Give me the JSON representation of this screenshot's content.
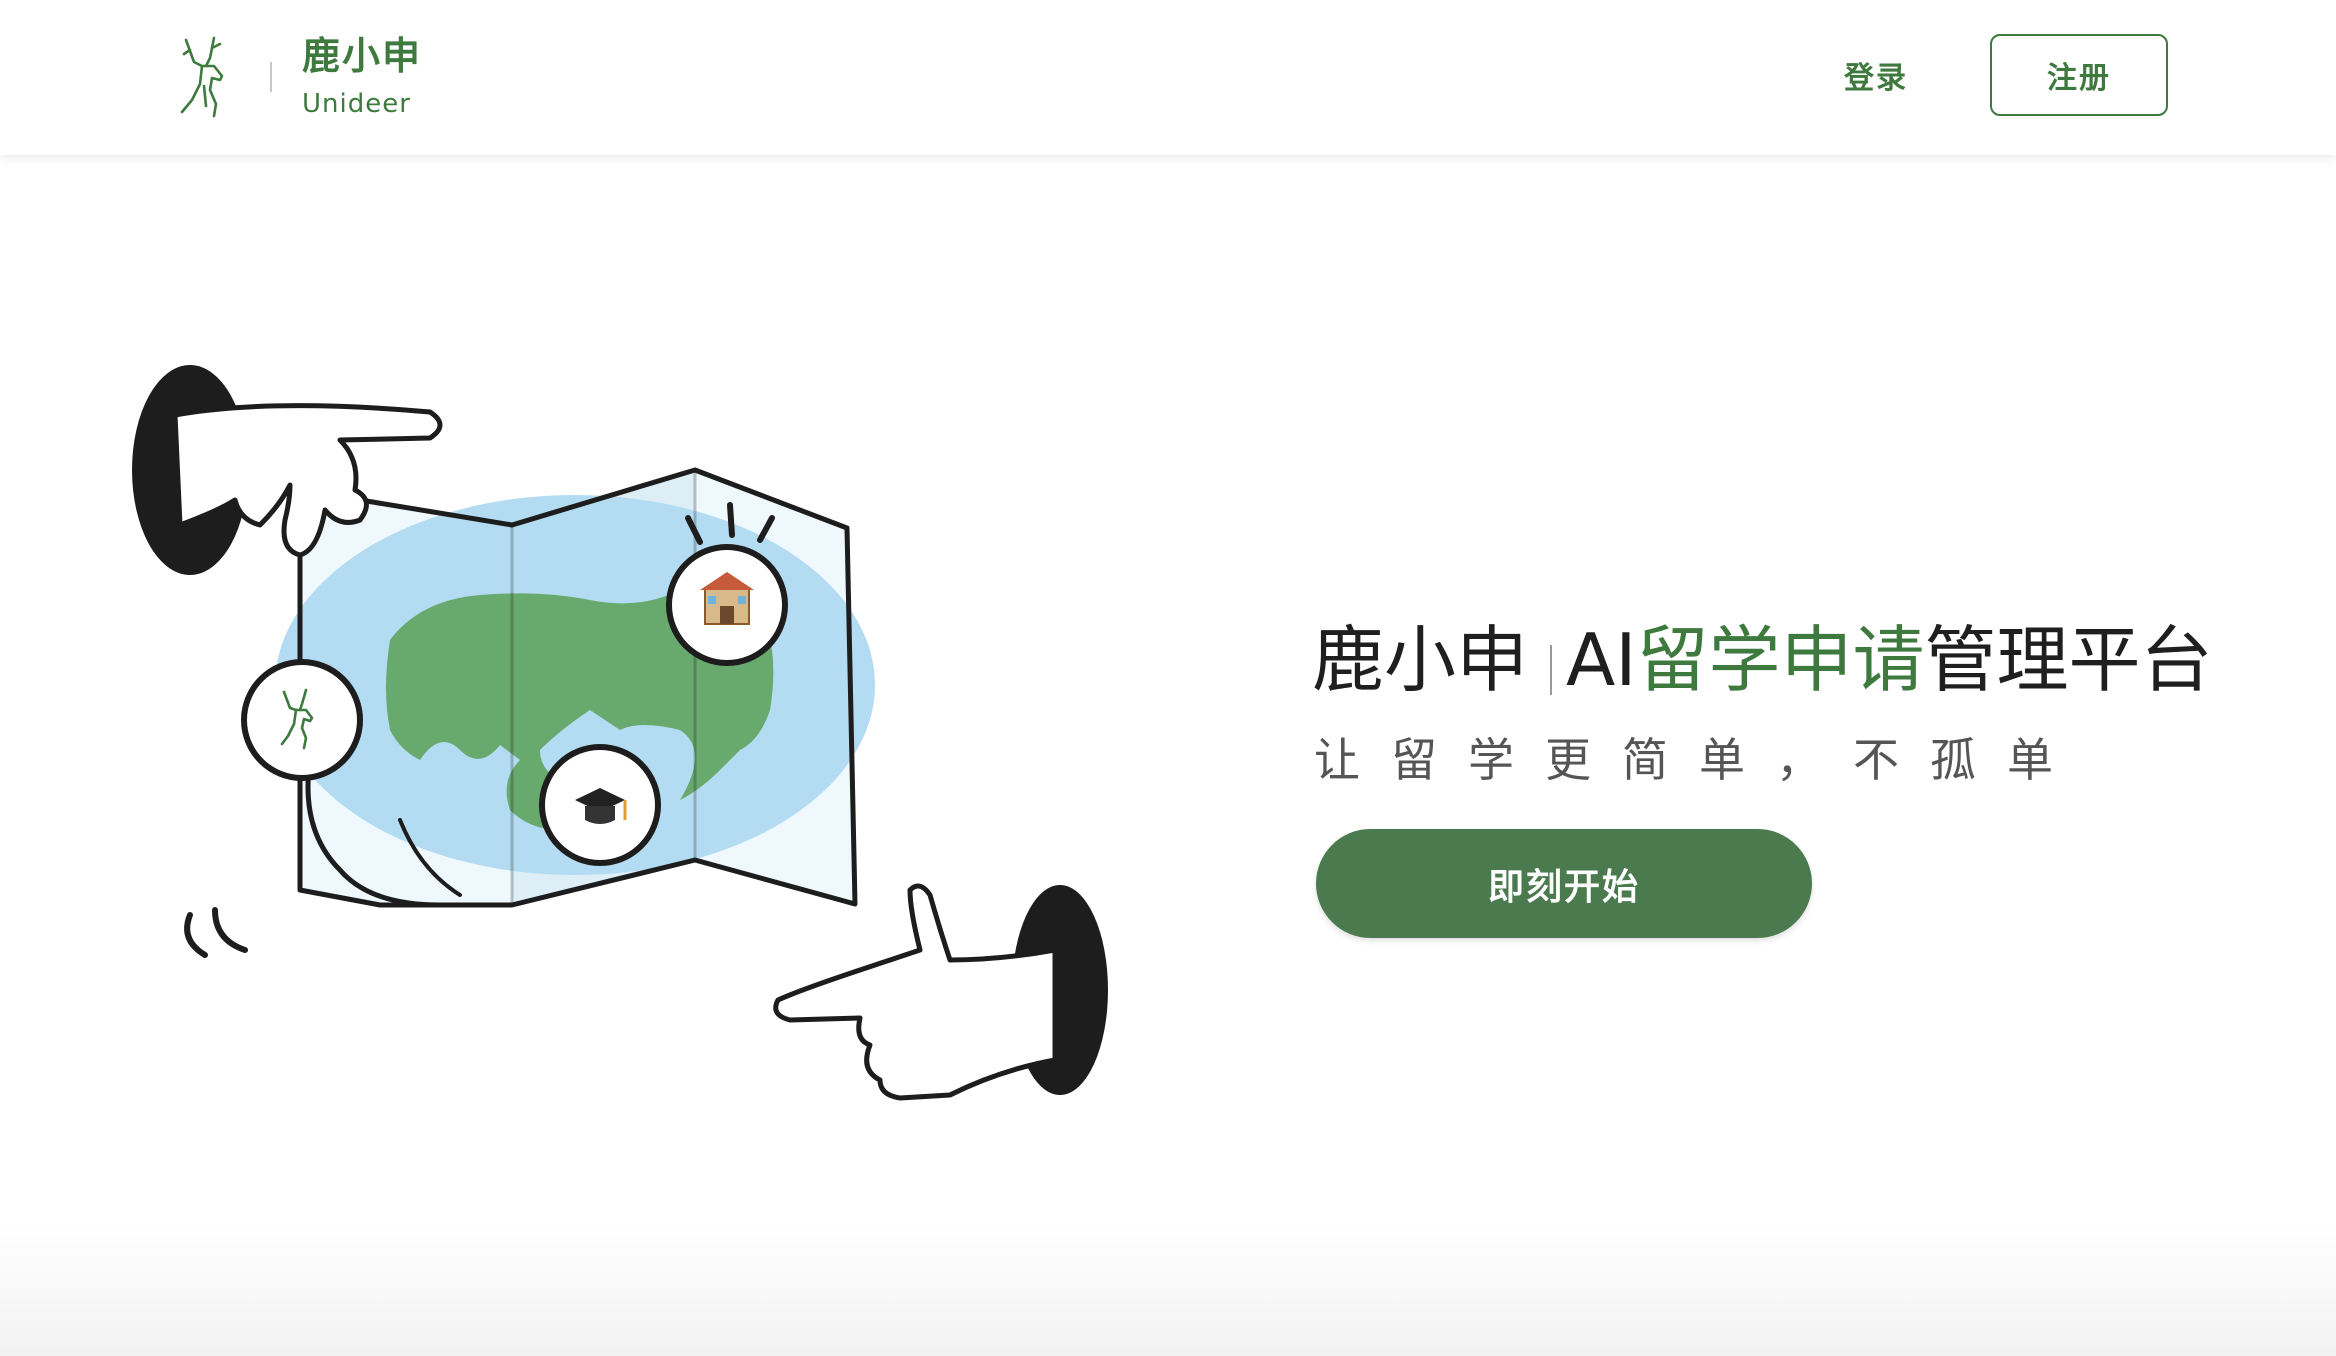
{
  "header": {
    "brand_name": "鹿小申",
    "brand_sub": "Unideer",
    "login_label": "登录",
    "register_label": "注册"
  },
  "hero": {
    "title_brand": "鹿小申",
    "title_ai": "AI ",
    "title_accent": "留学申请",
    "title_rest": "管理平台",
    "tagline": "让留学更简单，不孤单",
    "cta_label": "即刻开始"
  },
  "illustration": {
    "badges": [
      "school-building-icon",
      "graduation-cap-icon",
      "deer-logo-icon"
    ]
  },
  "colors": {
    "brand_green": "#3e7a3d",
    "cta_green": "#4a7a4d",
    "text_dark": "#1f1f1f",
    "text_muted": "#555555"
  }
}
